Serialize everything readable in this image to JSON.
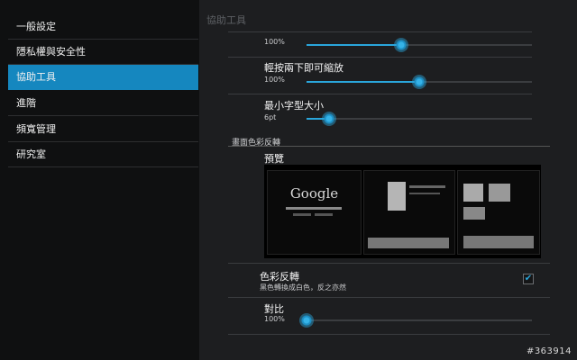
{
  "sidebar": {
    "items": [
      {
        "label": "一般設定"
      },
      {
        "label": "隱私權與安全性"
      },
      {
        "label": "協助工具"
      },
      {
        "label": "進階"
      },
      {
        "label": "頻寬管理"
      },
      {
        "label": "研究室"
      }
    ],
    "active_index": 2
  },
  "main": {
    "header": "協助工具",
    "text_scale": {
      "value_label": "100%",
      "value": 0.42
    },
    "double_tap_zoom": {
      "title": "輕按兩下即可縮放",
      "value_label": "100%",
      "value": 0.5
    },
    "min_font": {
      "title": "最小字型大小",
      "value_label": "6pt",
      "value": 0.1
    },
    "section_invert": "畫面色彩反轉",
    "preview": {
      "title": "預覽",
      "google_logo": "Google"
    },
    "invert": {
      "title": "色彩反轉",
      "summary": "黑色轉換成白色，反之亦然",
      "checked": true
    },
    "contrast": {
      "title": "對比",
      "value_label": "100%",
      "value": 0.0
    }
  },
  "watermark": "#363914",
  "colors": {
    "accent": "#1587bf",
    "slider": "#2aa6db"
  }
}
